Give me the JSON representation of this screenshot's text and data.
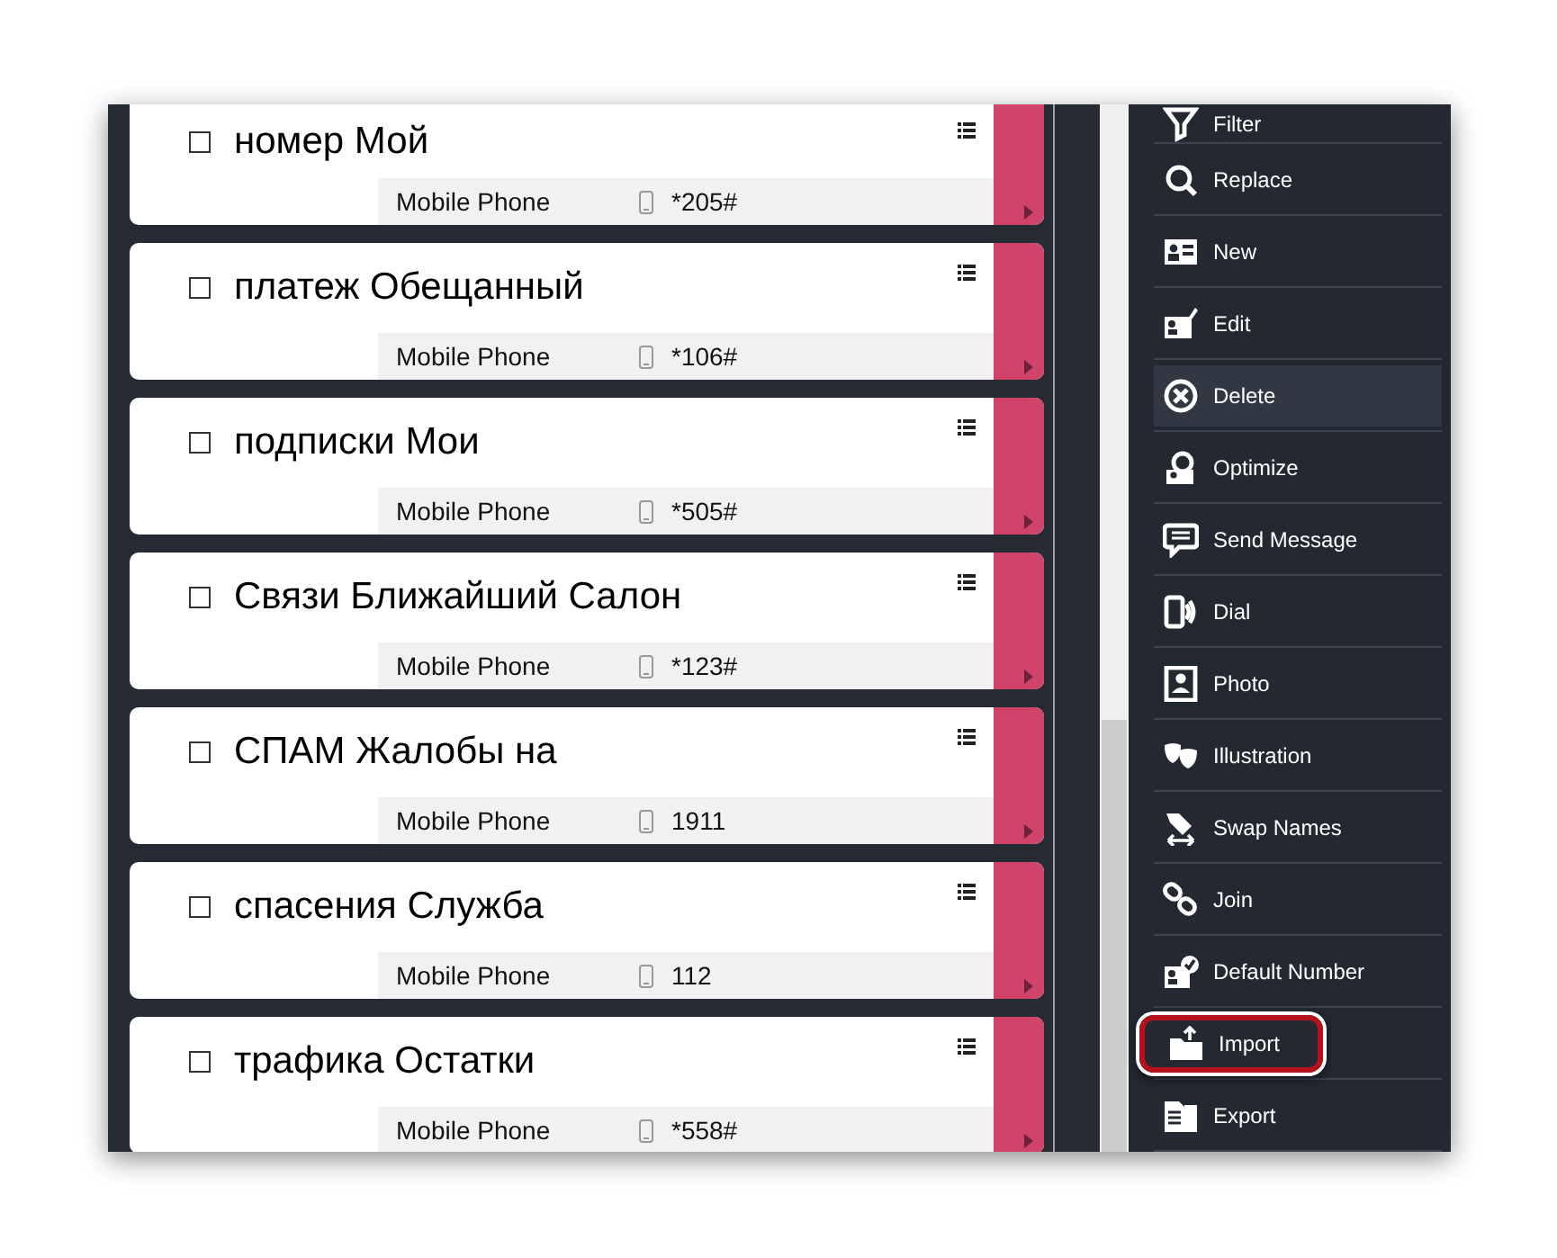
{
  "contacts": [
    {
      "name": "номер Мой",
      "type": "Mobile Phone",
      "number": "*205#",
      "checked": false
    },
    {
      "name": "платеж Обещанный",
      "type": "Mobile Phone",
      "number": "*106#",
      "checked": false
    },
    {
      "name": "подписки Мои",
      "type": "Mobile Phone",
      "number": "*505#",
      "checked": false
    },
    {
      "name": "Связи Ближайший Салон",
      "type": "Mobile Phone",
      "number": "*123#",
      "checked": false
    },
    {
      "name": "СПАМ Жалобы на",
      "type": "Mobile Phone",
      "number": "1911",
      "checked": false
    },
    {
      "name": "спасения Служба",
      "type": "Mobile Phone",
      "number": "112",
      "checked": false
    },
    {
      "name": "трафика Остатки",
      "type": "Mobile Phone",
      "number": "*558#",
      "checked": false
    }
  ],
  "menu": [
    {
      "label": "Filter",
      "selected": false,
      "outlined": false
    },
    {
      "label": "Replace",
      "selected": false,
      "outlined": false
    },
    {
      "label": "New",
      "selected": false,
      "outlined": false
    },
    {
      "label": "Edit",
      "selected": false,
      "outlined": false
    },
    {
      "label": "Delete",
      "selected": true,
      "outlined": false
    },
    {
      "label": "Optimize",
      "selected": false,
      "outlined": false
    },
    {
      "label": "Send Message",
      "selected": false,
      "outlined": false
    },
    {
      "label": "Dial",
      "selected": false,
      "outlined": false
    },
    {
      "label": "Photo",
      "selected": false,
      "outlined": false
    },
    {
      "label": "Illustration",
      "selected": false,
      "outlined": false
    },
    {
      "label": "Swap Names",
      "selected": false,
      "outlined": false
    },
    {
      "label": "Join",
      "selected": false,
      "outlined": false
    },
    {
      "label": "Default Number",
      "selected": false,
      "outlined": false
    },
    {
      "label": "Import",
      "selected": false,
      "outlined": true
    },
    {
      "label": "Export",
      "selected": false,
      "outlined": false
    }
  ]
}
